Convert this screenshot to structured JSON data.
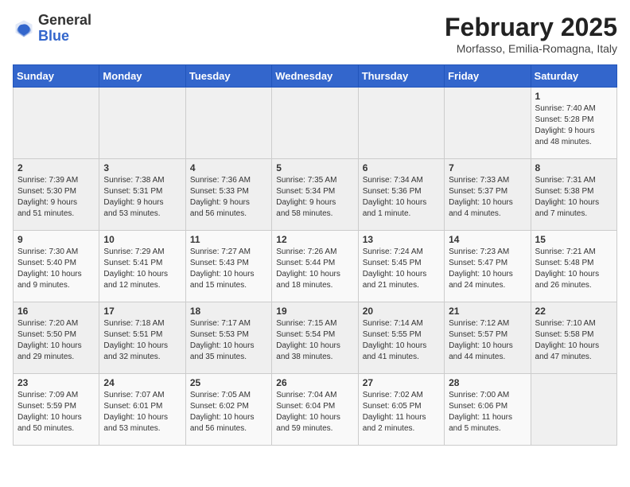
{
  "header": {
    "logo_general": "General",
    "logo_blue": "Blue",
    "title": "February 2025",
    "subtitle": "Morfasso, Emilia-Romagna, Italy"
  },
  "weekdays": [
    "Sunday",
    "Monday",
    "Tuesday",
    "Wednesday",
    "Thursday",
    "Friday",
    "Saturday"
  ],
  "weeks": [
    [
      {
        "day": "",
        "info": ""
      },
      {
        "day": "",
        "info": ""
      },
      {
        "day": "",
        "info": ""
      },
      {
        "day": "",
        "info": ""
      },
      {
        "day": "",
        "info": ""
      },
      {
        "day": "",
        "info": ""
      },
      {
        "day": "1",
        "info": "Sunrise: 7:40 AM\nSunset: 5:28 PM\nDaylight: 9 hours\nand 48 minutes."
      }
    ],
    [
      {
        "day": "2",
        "info": "Sunrise: 7:39 AM\nSunset: 5:30 PM\nDaylight: 9 hours\nand 51 minutes."
      },
      {
        "day": "3",
        "info": "Sunrise: 7:38 AM\nSunset: 5:31 PM\nDaylight: 9 hours\nand 53 minutes."
      },
      {
        "day": "4",
        "info": "Sunrise: 7:36 AM\nSunset: 5:33 PM\nDaylight: 9 hours\nand 56 minutes."
      },
      {
        "day": "5",
        "info": "Sunrise: 7:35 AM\nSunset: 5:34 PM\nDaylight: 9 hours\nand 58 minutes."
      },
      {
        "day": "6",
        "info": "Sunrise: 7:34 AM\nSunset: 5:36 PM\nDaylight: 10 hours\nand 1 minute."
      },
      {
        "day": "7",
        "info": "Sunrise: 7:33 AM\nSunset: 5:37 PM\nDaylight: 10 hours\nand 4 minutes."
      },
      {
        "day": "8",
        "info": "Sunrise: 7:31 AM\nSunset: 5:38 PM\nDaylight: 10 hours\nand 7 minutes."
      }
    ],
    [
      {
        "day": "9",
        "info": "Sunrise: 7:30 AM\nSunset: 5:40 PM\nDaylight: 10 hours\nand 9 minutes."
      },
      {
        "day": "10",
        "info": "Sunrise: 7:29 AM\nSunset: 5:41 PM\nDaylight: 10 hours\nand 12 minutes."
      },
      {
        "day": "11",
        "info": "Sunrise: 7:27 AM\nSunset: 5:43 PM\nDaylight: 10 hours\nand 15 minutes."
      },
      {
        "day": "12",
        "info": "Sunrise: 7:26 AM\nSunset: 5:44 PM\nDaylight: 10 hours\nand 18 minutes."
      },
      {
        "day": "13",
        "info": "Sunrise: 7:24 AM\nSunset: 5:45 PM\nDaylight: 10 hours\nand 21 minutes."
      },
      {
        "day": "14",
        "info": "Sunrise: 7:23 AM\nSunset: 5:47 PM\nDaylight: 10 hours\nand 24 minutes."
      },
      {
        "day": "15",
        "info": "Sunrise: 7:21 AM\nSunset: 5:48 PM\nDaylight: 10 hours\nand 26 minutes."
      }
    ],
    [
      {
        "day": "16",
        "info": "Sunrise: 7:20 AM\nSunset: 5:50 PM\nDaylight: 10 hours\nand 29 minutes."
      },
      {
        "day": "17",
        "info": "Sunrise: 7:18 AM\nSunset: 5:51 PM\nDaylight: 10 hours\nand 32 minutes."
      },
      {
        "day": "18",
        "info": "Sunrise: 7:17 AM\nSunset: 5:53 PM\nDaylight: 10 hours\nand 35 minutes."
      },
      {
        "day": "19",
        "info": "Sunrise: 7:15 AM\nSunset: 5:54 PM\nDaylight: 10 hours\nand 38 minutes."
      },
      {
        "day": "20",
        "info": "Sunrise: 7:14 AM\nSunset: 5:55 PM\nDaylight: 10 hours\nand 41 minutes."
      },
      {
        "day": "21",
        "info": "Sunrise: 7:12 AM\nSunset: 5:57 PM\nDaylight: 10 hours\nand 44 minutes."
      },
      {
        "day": "22",
        "info": "Sunrise: 7:10 AM\nSunset: 5:58 PM\nDaylight: 10 hours\nand 47 minutes."
      }
    ],
    [
      {
        "day": "23",
        "info": "Sunrise: 7:09 AM\nSunset: 5:59 PM\nDaylight: 10 hours\nand 50 minutes."
      },
      {
        "day": "24",
        "info": "Sunrise: 7:07 AM\nSunset: 6:01 PM\nDaylight: 10 hours\nand 53 minutes."
      },
      {
        "day": "25",
        "info": "Sunrise: 7:05 AM\nSunset: 6:02 PM\nDaylight: 10 hours\nand 56 minutes."
      },
      {
        "day": "26",
        "info": "Sunrise: 7:04 AM\nSunset: 6:04 PM\nDaylight: 10 hours\nand 59 minutes."
      },
      {
        "day": "27",
        "info": "Sunrise: 7:02 AM\nSunset: 6:05 PM\nDaylight: 11 hours\nand 2 minutes."
      },
      {
        "day": "28",
        "info": "Sunrise: 7:00 AM\nSunset: 6:06 PM\nDaylight: 11 hours\nand 5 minutes."
      },
      {
        "day": "",
        "info": ""
      }
    ]
  ]
}
